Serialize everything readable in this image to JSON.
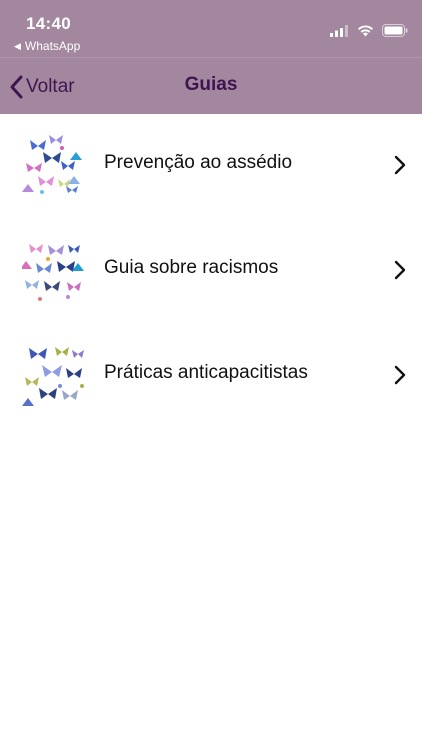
{
  "status_bar": {
    "time": "14:40",
    "back_app": "WhatsApp"
  },
  "nav": {
    "back_label": "Voltar",
    "title": "Guias"
  },
  "guides": [
    {
      "label": "Prevenção ao assédio"
    },
    {
      "label": "Guia sobre racismos"
    },
    {
      "label": "Práticas anticapacitistas"
    }
  ],
  "colors": {
    "header_bg": "#a3879f",
    "nav_text": "#3e1550",
    "row_text": "#111111"
  },
  "icons": {
    "back": "chevron-left",
    "row_disclosure": "chevron-right"
  }
}
